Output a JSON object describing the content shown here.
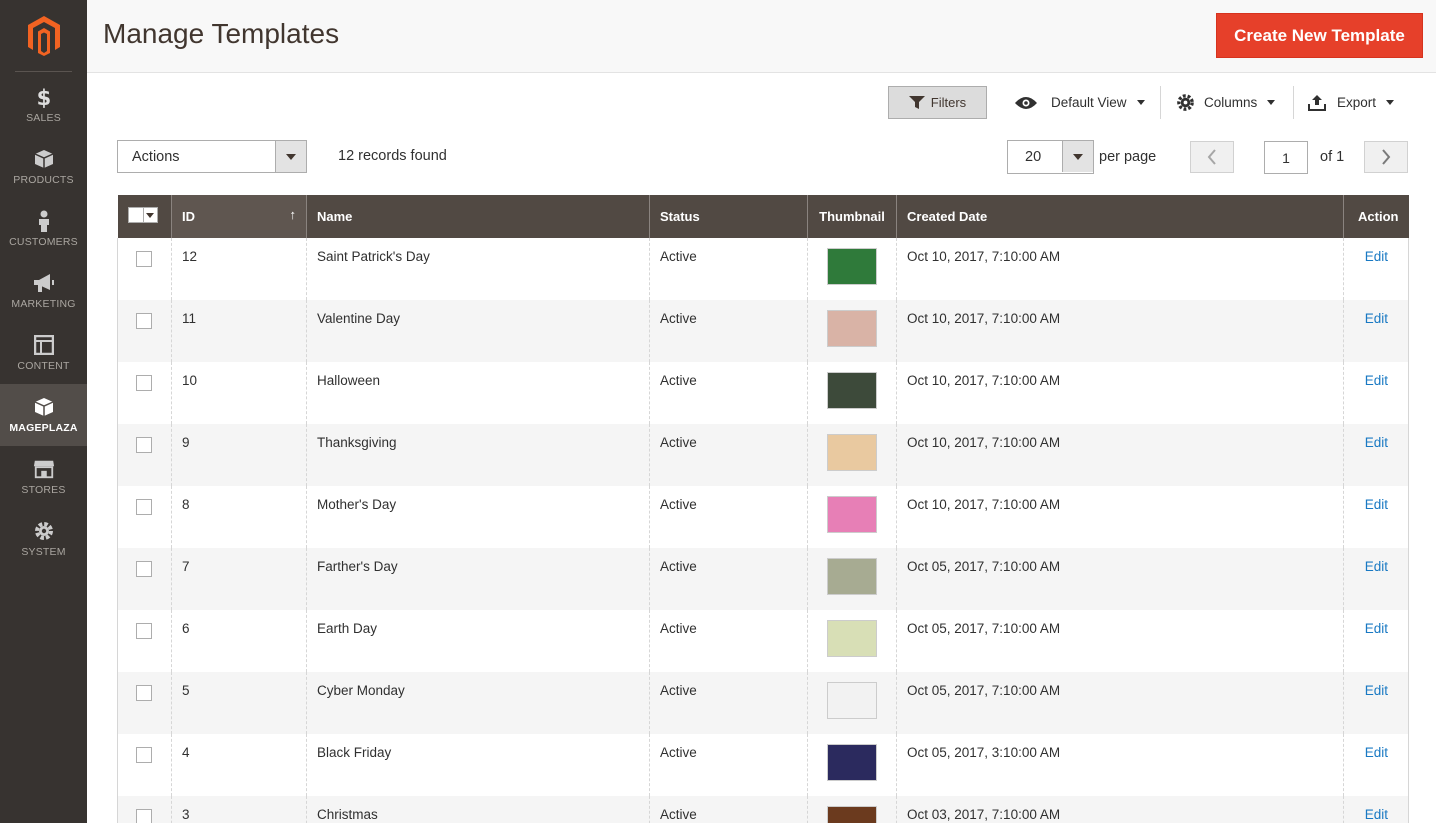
{
  "colors": {
    "sidebar_bg": "#373330",
    "accent": "#e6402a",
    "grid_header": "#514943",
    "link": "#1979c3"
  },
  "sidebar": {
    "logo_icon": "magento-logo-icon",
    "items": [
      {
        "label": "SALES",
        "icon": "dollar-icon",
        "active": false
      },
      {
        "label": "PRODUCTS",
        "icon": "box-icon",
        "active": false
      },
      {
        "label": "CUSTOMERS",
        "icon": "person-icon",
        "active": false
      },
      {
        "label": "MARKETING",
        "icon": "megaphone-icon",
        "active": false
      },
      {
        "label": "CONTENT",
        "icon": "layout-icon",
        "active": false
      },
      {
        "label": "MAGEPLAZA",
        "icon": "cube-icon",
        "active": true
      },
      {
        "label": "STORES",
        "icon": "storefront-icon",
        "active": false
      },
      {
        "label": "SYSTEM",
        "icon": "gear-icon",
        "active": false
      }
    ]
  },
  "header": {
    "title": "Manage Templates",
    "create_button": "Create New Template"
  },
  "toolbar": {
    "filters": "Filters",
    "view": "Default View",
    "columns": "Columns",
    "export": "Export",
    "actions": "Actions",
    "records": "12 records found",
    "per_page_value": "20",
    "per_page_label": "per page",
    "page_value": "1",
    "page_of": "of 1"
  },
  "grid": {
    "headers": {
      "id": "ID",
      "name": "Name",
      "status": "Status",
      "thumbnail": "Thumbnail",
      "created": "Created Date",
      "action": "Action"
    },
    "rows": [
      {
        "id": "12",
        "name": "Saint Patrick's Day",
        "status": "Active",
        "created": "Oct 10, 2017, 7:10:00 AM",
        "action": "Edit",
        "thumb_color": "#2f7a3a"
      },
      {
        "id": "11",
        "name": "Valentine Day",
        "status": "Active",
        "created": "Oct 10, 2017, 7:10:00 AM",
        "action": "Edit",
        "thumb_color": "#d9b3a6"
      },
      {
        "id": "10",
        "name": "Halloween",
        "status": "Active",
        "created": "Oct 10, 2017, 7:10:00 AM",
        "action": "Edit",
        "thumb_color": "#3d4a3a"
      },
      {
        "id": "9",
        "name": "Thanksgiving",
        "status": "Active",
        "created": "Oct 10, 2017, 7:10:00 AM",
        "action": "Edit",
        "thumb_color": "#e9c9a0"
      },
      {
        "id": "8",
        "name": "Mother's Day",
        "status": "Active",
        "created": "Oct 10, 2017, 7:10:00 AM",
        "action": "Edit",
        "thumb_color": "#e77fb6"
      },
      {
        "id": "7",
        "name": "Farther's Day",
        "status": "Active",
        "created": "Oct 05, 2017, 7:10:00 AM",
        "action": "Edit",
        "thumb_color": "#a7ab92"
      },
      {
        "id": "6",
        "name": "Earth Day",
        "status": "Active",
        "created": "Oct 05, 2017, 7:10:00 AM",
        "action": "Edit",
        "thumb_color": "#d8dfb6"
      },
      {
        "id": "5",
        "name": "Cyber Monday",
        "status": "Active",
        "created": "Oct 05, 2017, 7:10:00 AM",
        "action": "Edit",
        "thumb_color": "#f2f2f2"
      },
      {
        "id": "4",
        "name": "Black Friday",
        "status": "Active",
        "created": "Oct 05, 2017, 3:10:00 AM",
        "action": "Edit",
        "thumb_color": "#2b2a5e"
      },
      {
        "id": "3",
        "name": "Christmas",
        "status": "Active",
        "created": "Oct 03, 2017, 7:10:00 AM",
        "action": "Edit",
        "thumb_color": "#6b3a1e"
      }
    ]
  }
}
